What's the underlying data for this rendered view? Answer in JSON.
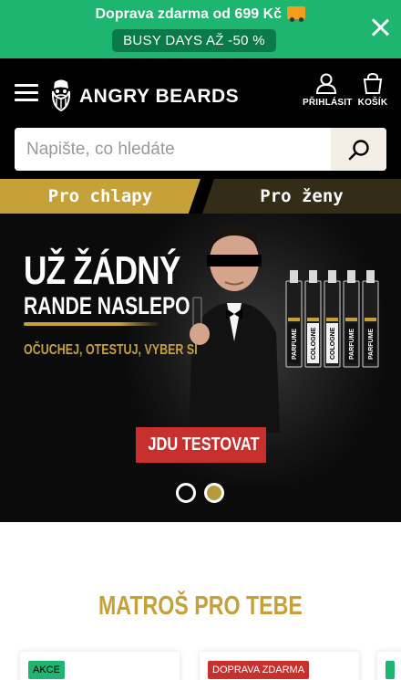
{
  "promo": {
    "text": "Doprava zdarma od 699 Kč",
    "pill": "BUSY DAYS AŽ -50 %"
  },
  "header": {
    "logo_text": "ANGRY BEARDS",
    "login_label": "PŘIHLÁSIT",
    "cart_label": "KOŠÍK"
  },
  "search": {
    "placeholder": "Napište, co hledáte"
  },
  "tabs": {
    "men": "Pro chlapy",
    "women": "Pro ženy"
  },
  "hero": {
    "headline": "UŽ ŽÁDNÝ",
    "subheadline": "RANDE NASLEPO",
    "tagline": "OČUCHEJ, OTESTUJ, VYBER SI",
    "cta": "JDU TESTOVAT",
    "vial_labels": [
      "PARFUME",
      "COLOGNE",
      "COLOGNE",
      "PARFUME",
      "PARFUME"
    ],
    "slide_count": 2,
    "active_slide": 2
  },
  "section": {
    "title": "MATROŠ PRO TEBE"
  },
  "products": [
    {
      "badge": "AKCE"
    },
    {
      "badge": "DOPRAVA ZDARMA"
    }
  ],
  "colors": {
    "promo_green": "#1db56f",
    "gold": "#c6a038",
    "cta_red": "#c8302e",
    "header_black": "#000000"
  },
  "icons": {
    "menu": "hamburger-menu-icon",
    "user": "user-icon",
    "cart": "shopping-bag-icon",
    "search": "search-icon",
    "close": "close-icon",
    "truck": "delivery-truck-icon"
  }
}
